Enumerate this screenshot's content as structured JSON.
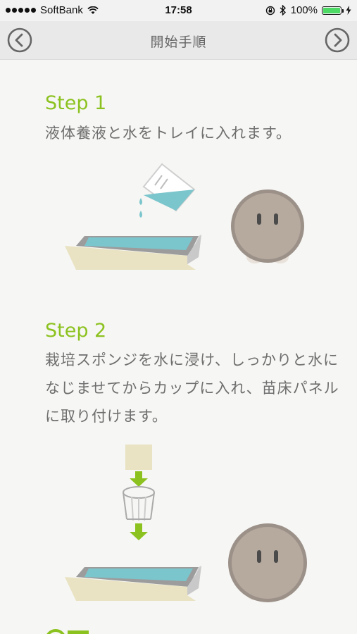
{
  "status": {
    "carrier": "SoftBank",
    "time": "17:58",
    "battery": "100%"
  },
  "nav": {
    "title": "開始手順",
    "back_icon": "chevron-left-circle-icon",
    "forward_icon": "chevron-right-circle-icon"
  },
  "steps": [
    {
      "title": "Step 1",
      "description": "液体養液と水をトレイに入れます。"
    },
    {
      "title": "Step 2",
      "description": "栽培スポンジを水に浸け、しっかりと水になじませてからカップに入れ、苗床パネルに取り付けます。"
    }
  ],
  "colors": {
    "accent": "#8cc21f",
    "water": "#7bc5cc",
    "tray": "#e9e3c3",
    "character": "#b6a99d"
  }
}
